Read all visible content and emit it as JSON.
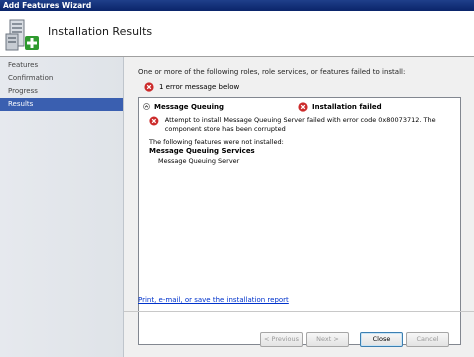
{
  "window": {
    "title": "Add Features Wizard"
  },
  "header": {
    "title": "Installation Results",
    "icon": "server-add-feature-icon"
  },
  "sidebar": {
    "items": [
      {
        "label": "Features",
        "active": false
      },
      {
        "label": "Confirmation",
        "active": false
      },
      {
        "label": "Progress",
        "active": false
      },
      {
        "label": "Results",
        "active": true
      }
    ]
  },
  "main": {
    "intro": "One or more of the following roles, role services, or features failed to install:",
    "error_count": "1 error message below",
    "results": {
      "feature_name": "Message Queuing",
      "status": "Installation failed",
      "detail": "Attempt to install Message Queuing Server failed with error code 0x80073712.  The component store has been corrupted",
      "not_installed_label": "The following features were not installed:",
      "service_title": "Message Queuing Services",
      "service_item": "Message Queuing Server"
    },
    "report_link": "Print, e-mail, or save the installation report"
  },
  "buttons": {
    "previous": "< Previous",
    "next": "Next >",
    "close": "Close",
    "cancel": "Cancel"
  },
  "colors": {
    "error": "#cc2b2b",
    "link": "#0033cc",
    "selection": "#3a5fb0",
    "titlebar": "#0a246a"
  }
}
